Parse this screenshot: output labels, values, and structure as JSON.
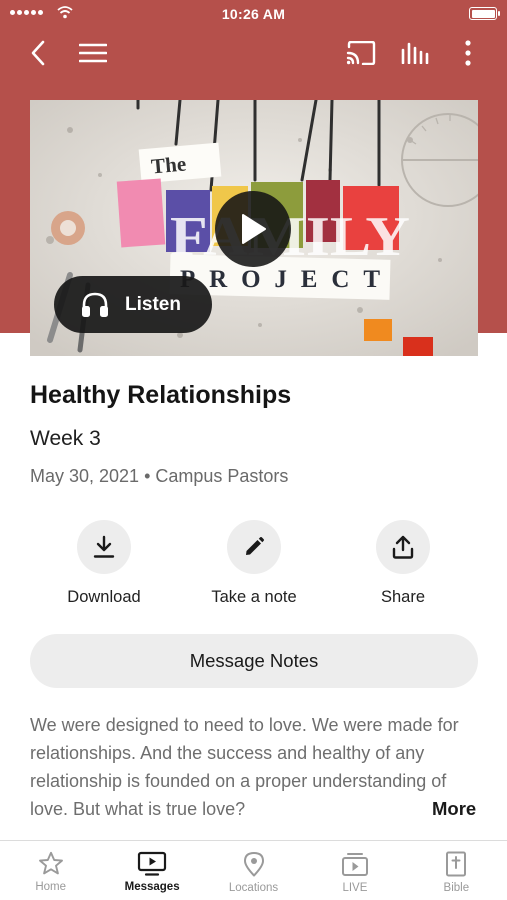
{
  "status_bar": {
    "time": "10:26 AM"
  },
  "media": {
    "thumbnail_text": {
      "the": "The",
      "family": "FAMILY",
      "project": "PROJECT"
    },
    "listen_label": "Listen"
  },
  "message": {
    "title": "Healthy Relationships",
    "subtitle": "Week 3",
    "meta": "May 30, 2021 • Campus Pastors"
  },
  "actions": [
    {
      "label": "Download",
      "icon": "download-icon"
    },
    {
      "label": "Take a note",
      "icon": "pencil-icon"
    },
    {
      "label": "Share",
      "icon": "share-icon"
    }
  ],
  "notes_button": {
    "label": "Message Notes"
  },
  "description": {
    "text": "We were designed to need to love. We were made for relationships. And the success and healthy of any relationship is founded on a proper understanding of love. But what is true love?",
    "more_label": "More"
  },
  "tabs": [
    {
      "label": "Home",
      "icon": "star-icon",
      "active": false
    },
    {
      "label": "Messages",
      "icon": "play-screen-icon",
      "active": true
    },
    {
      "label": "Locations",
      "icon": "location-pin-icon",
      "active": false
    },
    {
      "label": "LIVE",
      "icon": "live-tv-icon",
      "active": false
    },
    {
      "label": "Bible",
      "icon": "bible-icon",
      "active": false
    }
  ],
  "colors": {
    "header_bg": "#b5504b",
    "chip_bg": "#ededed",
    "text_muted": "#6e6e6e"
  }
}
